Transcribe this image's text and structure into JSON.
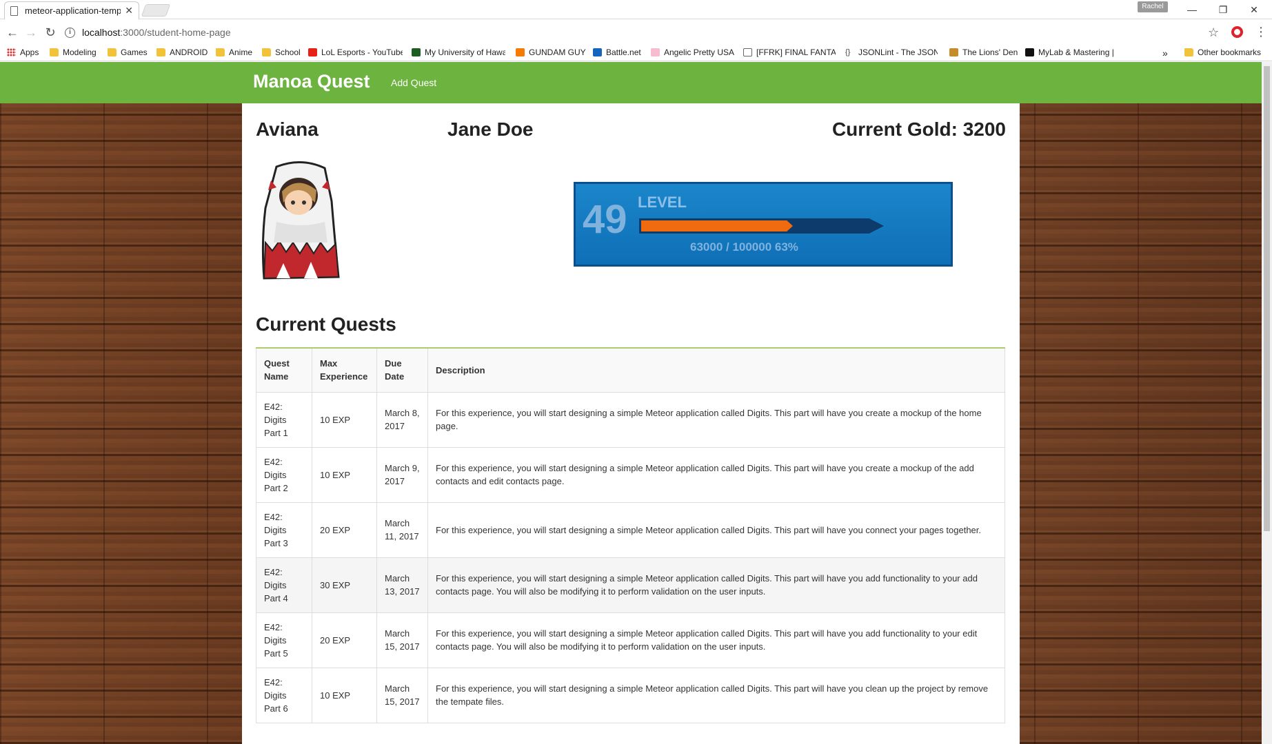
{
  "browser": {
    "tab_title": "meteor-application-temp",
    "tab_close": "✕",
    "user": "Rachel",
    "url_host": "localhost",
    "url_path": ":3000/student-home-page",
    "bookmarks": [
      {
        "label": "Apps"
      },
      {
        "label": "Modeling"
      },
      {
        "label": "Games"
      },
      {
        "label": "ANDROID"
      },
      {
        "label": "Anime"
      },
      {
        "label": "School"
      },
      {
        "label": "LoL Esports - YouTube"
      },
      {
        "label": "My University of Hawai"
      },
      {
        "label": "GUNDAM GUY"
      },
      {
        "label": "Battle.net"
      },
      {
        "label": "Angelic Pretty USA"
      },
      {
        "label": "[FFRK] FINAL FANTASY"
      },
      {
        "label": "JSONLint - The JSON"
      },
      {
        "label": "The Lions' Den"
      },
      {
        "label": "MyLab & Mastering |"
      }
    ],
    "overflow": "»",
    "other_bookmarks": "Other bookmarks"
  },
  "navbar": {
    "brand": "Manoa Quest",
    "add_quest": "Add Quest"
  },
  "profile": {
    "character_name": "Aviana",
    "student_name": "Jane Doe",
    "gold": "Current Gold: 3200",
    "level": "49",
    "level_label": "LEVEL",
    "progress_text": "63000 / 100000  63%",
    "progress_fraction": 0.63
  },
  "quests": {
    "title": "Current Quests",
    "headers": [
      "Quest Name",
      "Max Experience",
      "Due Date",
      "Description"
    ],
    "rows": [
      {
        "name": "E42: Digits Part 1",
        "exp": "10 EXP",
        "due": "March 8, 2017",
        "desc": "For this experience, you will start designing a simple Meteor application called Digits. This part will have you create a mockup of the home page."
      },
      {
        "name": "E42: Digits Part 2",
        "exp": "10 EXP",
        "due": "March 9, 2017",
        "desc": "For this experience, you will start designing a simple Meteor application called Digits. This part will have you create a mockup of the add contacts and edit contacts page."
      },
      {
        "name": "E42: Digits Part 3",
        "exp": "20 EXP",
        "due": "March 11, 2017",
        "desc": "For this experience, you will start designing a simple Meteor application called Digits. This part will have you connect your pages together."
      },
      {
        "name": "E42: Digits Part 4",
        "exp": "30 EXP",
        "due": "March 13, 2017",
        "desc": "For this experience, you will start designing a simple Meteor application called Digits. This part will have you add functionality to your add contacts page. You will also be modifying it to perform validation on the user inputs."
      },
      {
        "name": "E42: Digits Part 5",
        "exp": "20 EXP",
        "due": "March 15, 2017",
        "desc": "For this experience, you will start designing a simple Meteor application called Digits. This part will have you add functionality to your edit contacts page. You will also be modifying it to perform validation on the user inputs."
      },
      {
        "name": "E42: Digits Part 6",
        "exp": "10 EXP",
        "due": "March 15, 2017",
        "desc": "For this experience, you will start designing a simple Meteor application called Digits. This part will have you clean up the project by remove the tempate files."
      }
    ]
  }
}
